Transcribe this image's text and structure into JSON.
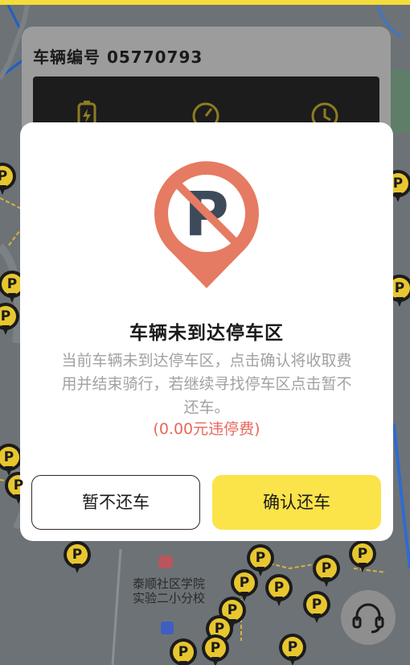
{
  "vehicle_card": {
    "title": "车辆编号 05770793",
    "icons": [
      "battery-icon",
      "speedometer-icon",
      "clock-icon"
    ]
  },
  "map": {
    "poi_label": "泰顺社区学院\n实验二小分校",
    "pin_label": "P"
  },
  "modal": {
    "title": "车辆未到达停车区",
    "message": "当前车辆未到达停车区，点击确认将收取费用并结束骑行，若继续寻找停车区点击暂不还车。",
    "fee": "(0.00元违停费)",
    "cancel_label": "暂不还车",
    "confirm_label": "确认还车",
    "icon": "no-parking-icon"
  },
  "colors": {
    "accent_yellow": "#fbe34a",
    "warning_red": "#e8685b",
    "no_parking_orange": "#e57b62"
  },
  "support_button": {
    "icon": "headset-icon"
  }
}
